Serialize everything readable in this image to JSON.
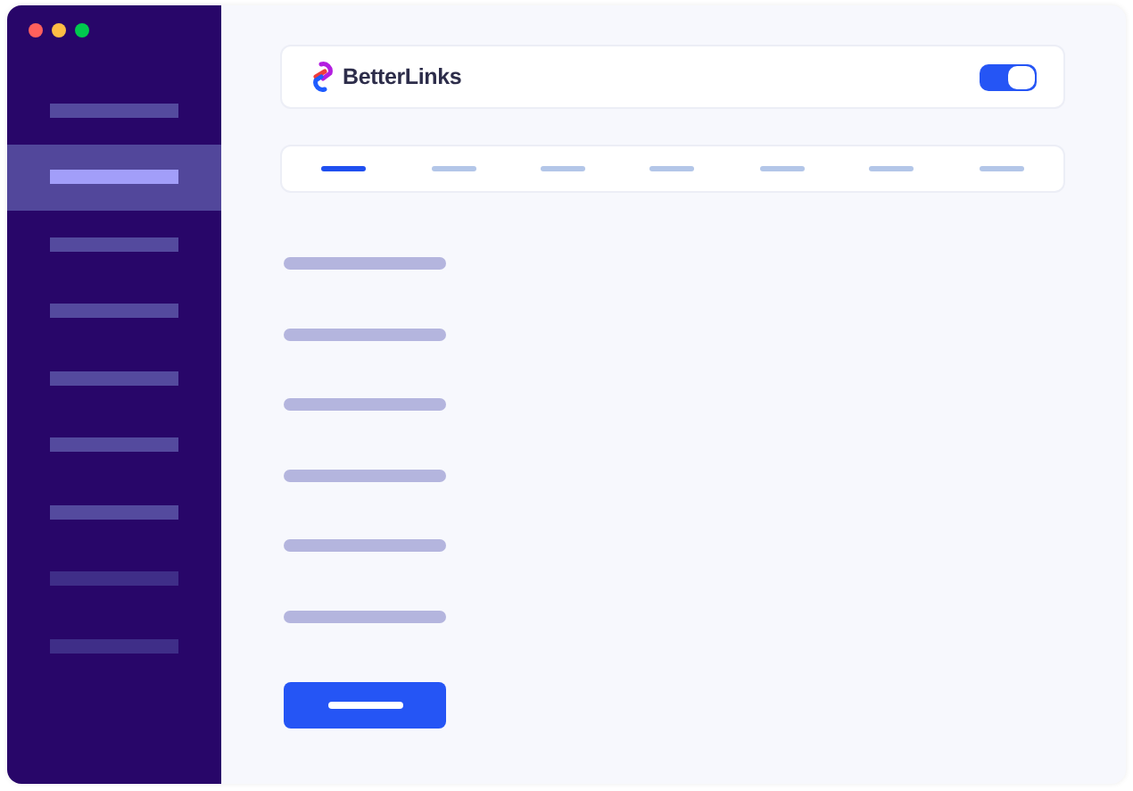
{
  "window": {
    "controls": [
      {
        "color": "#ff605c"
      },
      {
        "color": "#ffbd44"
      },
      {
        "color": "#00ca4e"
      }
    ]
  },
  "sidebar": {
    "items": [
      {
        "selected": false,
        "disabled": false
      },
      {
        "selected": true,
        "disabled": false
      },
      {
        "selected": false,
        "disabled": false
      },
      {
        "selected": false,
        "disabled": false
      },
      {
        "selected": false,
        "disabled": false
      },
      {
        "selected": false,
        "disabled": false
      },
      {
        "selected": false,
        "disabled": false
      },
      {
        "selected": false,
        "disabled": true
      },
      {
        "selected": false,
        "disabled": true
      }
    ]
  },
  "header": {
    "logo_text": "BetterLinks",
    "toggle": {
      "on": true
    }
  },
  "tabs": [
    {
      "selected": true
    },
    {
      "selected": false
    },
    {
      "selected": false
    },
    {
      "selected": false
    },
    {
      "selected": false
    },
    {
      "selected": false
    },
    {
      "selected": false
    }
  ],
  "form": {
    "rows": [
      {
        "kind": "label"
      },
      {
        "kind": "label"
      },
      {
        "kind": "label"
      },
      {
        "kind": "label"
      },
      {
        "kind": "label"
      },
      {
        "kind": "label"
      }
    ]
  },
  "button": {
    "kind": "primary"
  }
}
